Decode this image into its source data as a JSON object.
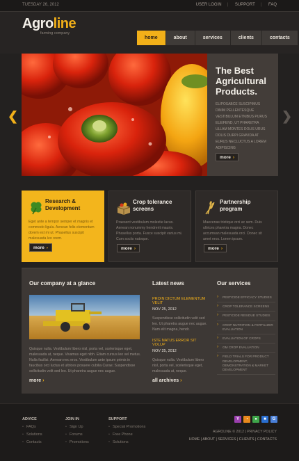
{
  "topbar": {
    "date": "TUESDAY 26, 2012",
    "links": [
      "USER LOGIN",
      "SUPPORT",
      "FAQ"
    ]
  },
  "logo": {
    "part1": "Agro",
    "part2": "line",
    "tagline": "farming company"
  },
  "nav": [
    "home",
    "about",
    "services",
    "clients",
    "contacts"
  ],
  "slider": {
    "title_line1": "The Best",
    "title_line2": "Agricultural",
    "title_line3": "Products.",
    "text": "ELIPOSABCE SUSCIPIMUS DINIM PELLENTESQUE VESTIBULUM ETNIBUS PURUS ELEIFEND, UT PHARETRA ULLAM MONTES DOLIS URUS DOLIS DURPI GRAVIDA AT EURUS NECLUCTUS A LOREM ADIPISCING",
    "button": "more",
    "prev_icon": "chevron-left-icon",
    "next_icon": "chevron-right-icon"
  },
  "boxes": [
    {
      "title1": "Research &",
      "title2": "Development",
      "text": "Eget ante a tempor semper et magnis et commodo ligula. Aenean felis elementum dorem est mi ut. Phasellus suscipit malesuada leo orem.",
      "button": "more",
      "icon": "clover-icon"
    },
    {
      "title1": "Crop tolerance",
      "title2": "screens",
      "text": "Praesent vestibulum molestie lacus. Aenean nonummy hendrerit mauris. Phasellus porta. Fusce suscipit varius mi. Cum sociis natoque.",
      "button": "more",
      "icon": "crate-icon"
    },
    {
      "title1": "Partnership",
      "title2": "program",
      "text": "Maecenas tristique orci ac sem. Duis ultrices pharetra magna. Donec accumsan malesuada orci. Donec sit amet eros. Lorem ipsum.",
      "button": "more",
      "icon": "wheat-icon"
    }
  ],
  "glance": {
    "title": "Our company at a glance",
    "text": "Quisque nulla. Vestibulum libero nisl, porta vel, scelerisque eget, malesuada at, neque. Vivamus eget nibh. Etiam cursus leo vel metus. Nulla facilisi. Aenean nec eros. Vestibulum ante ipsum primis in faucibus orci luctus et ultrices posuere cubilia Curae; Suspendisse sollicitudin velit sed leo. Ut pharetra augue nec augue.",
    "more": "more"
  },
  "news": {
    "title": "Latest news",
    "items": [
      {
        "heading": "PROIN DICTUM ELEMENTUM VELIT",
        "date": "NOV 25, 2012",
        "text": "Suspendisse sollicitudin velit sed leo. Ut pharetra augue nec augue. Nam elit magna, hendr."
      },
      {
        "heading": "ISTE NATUS ERROR SIT VOLUP",
        "date": "NOV 25, 2012",
        "text": "Quisque nulla. Vestibulum libero nisl, porta vel, scelerisque eget, malesuada at, neque."
      }
    ],
    "more": "all archives"
  },
  "services": {
    "title": "Our services",
    "items": [
      "PESTICIDE EFFICACY STUDIES",
      "CROP TOLERANCE SCREENS",
      "PESTICIDE RESIDUE STUDIES",
      "CROP NUTRITION & FERTILIZER EVALUATION",
      "EVALUATION OF CROPS",
      "GM CROP EVALUATION",
      "FIELD TRIALS FOR PRODUCT DEVELOPMENT, DEMONSTRATION & MARKET DEVELOPMENT"
    ]
  },
  "footer": {
    "cols": [
      {
        "title": "ADVICE",
        "items": [
          "FAQs",
          "Solutions",
          "Contacts"
        ]
      },
      {
        "title": "JOIN IN",
        "items": [
          "Sign Up",
          "Forums",
          "Promotions"
        ]
      },
      {
        "title": "SUPPORT",
        "items": [
          "Special Promotions",
          "Free Phone",
          "Solutions"
        ]
      }
    ],
    "social": [
      {
        "icon": "yahoo-icon",
        "glyph": "Y",
        "color": "#9b3fae"
      },
      {
        "icon": "rss-icon",
        "glyph": "◔",
        "color": "#e8891d"
      },
      {
        "icon": "messenger-icon",
        "glyph": "●",
        "color": "#3fa64b"
      },
      {
        "icon": "delicious-icon",
        "glyph": "■",
        "color": "#2a6fd1"
      },
      {
        "icon": "google-icon",
        "glyph": "G",
        "color": "#4a80d9"
      }
    ],
    "copyright": "AGROLINE © 2012 | PRIVACY POLICY",
    "links": "HOME | ABOUT | SERVICES | CLIENTS | CONTACTS"
  },
  "colors": {
    "accent": "#f2b019",
    "background": "#232120",
    "panel": "#3d3835"
  }
}
